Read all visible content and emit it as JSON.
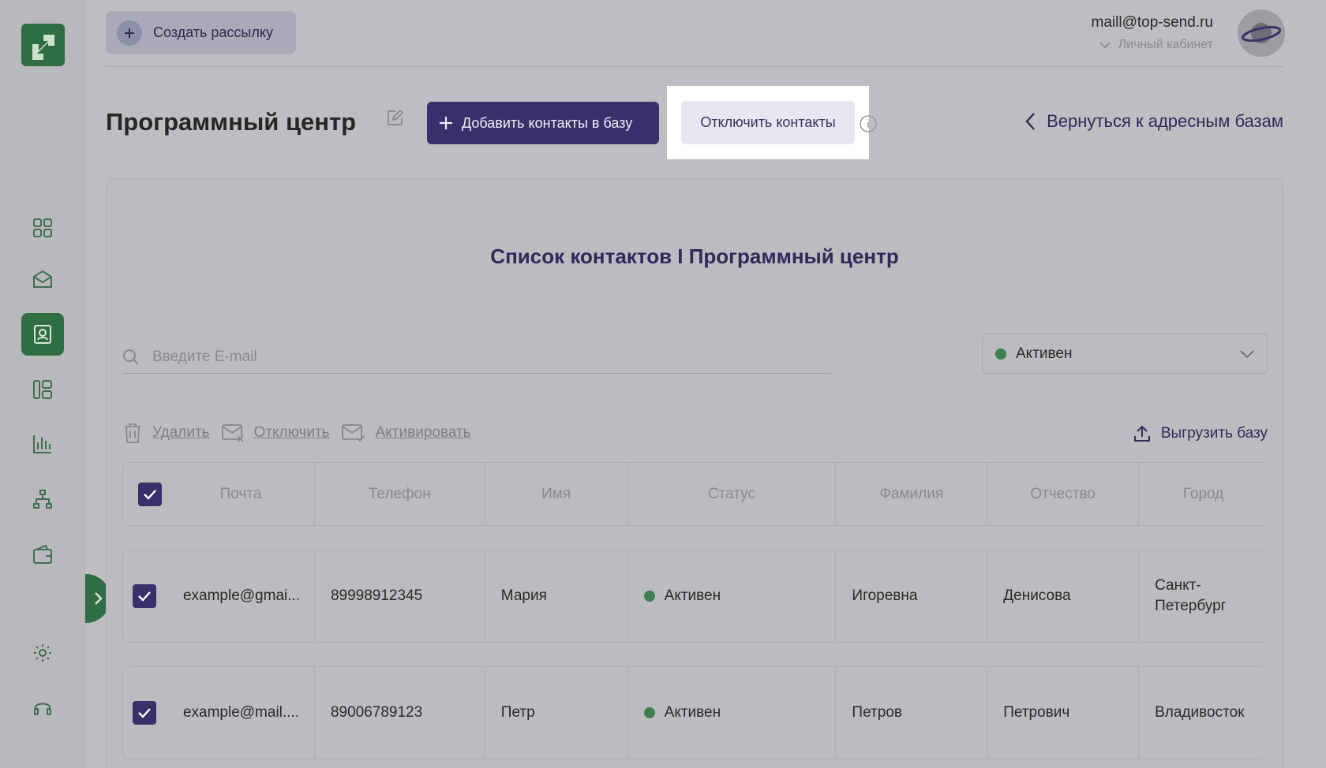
{
  "header": {
    "create_button": "Создать рассылку",
    "user_email": "maill@top-send.ru",
    "account_label": "Личный кабинет"
  },
  "page": {
    "title": "Программный центр",
    "add_contacts_button": "Добавить контакты в базу",
    "disable_contacts_button": "Отключить контакты",
    "back_link": "Вернуться к адресным базам"
  },
  "list": {
    "title": "Список контактов I Программный центр",
    "search_placeholder": "Введите E-mail",
    "status_filter": "Активен"
  },
  "actions": {
    "delete": "Удалить",
    "disable": "Отключить",
    "activate": "Активировать",
    "export": "Выгрузить базу"
  },
  "table": {
    "columns": [
      "Почта",
      "Телефон",
      "Имя",
      "Статус",
      "Фамилия",
      "Отчество",
      "Город"
    ],
    "rows": [
      {
        "email": "example@gmai...",
        "phone": "89998912345",
        "name": "Мария",
        "status": "Активен",
        "last": "Игоревна",
        "middle": "Денисова",
        "city": "Санкт-Петербург"
      },
      {
        "email": "example@mail....",
        "phone": "89006789123",
        "name": "Петр",
        "status": "Активен",
        "last": "Петров",
        "middle": "Петрович",
        "city": "Владивосток"
      }
    ]
  },
  "colors": {
    "brand_green": "#2f6e42",
    "primary_purple": "#38306a",
    "status_active": "#3e7e4f"
  }
}
